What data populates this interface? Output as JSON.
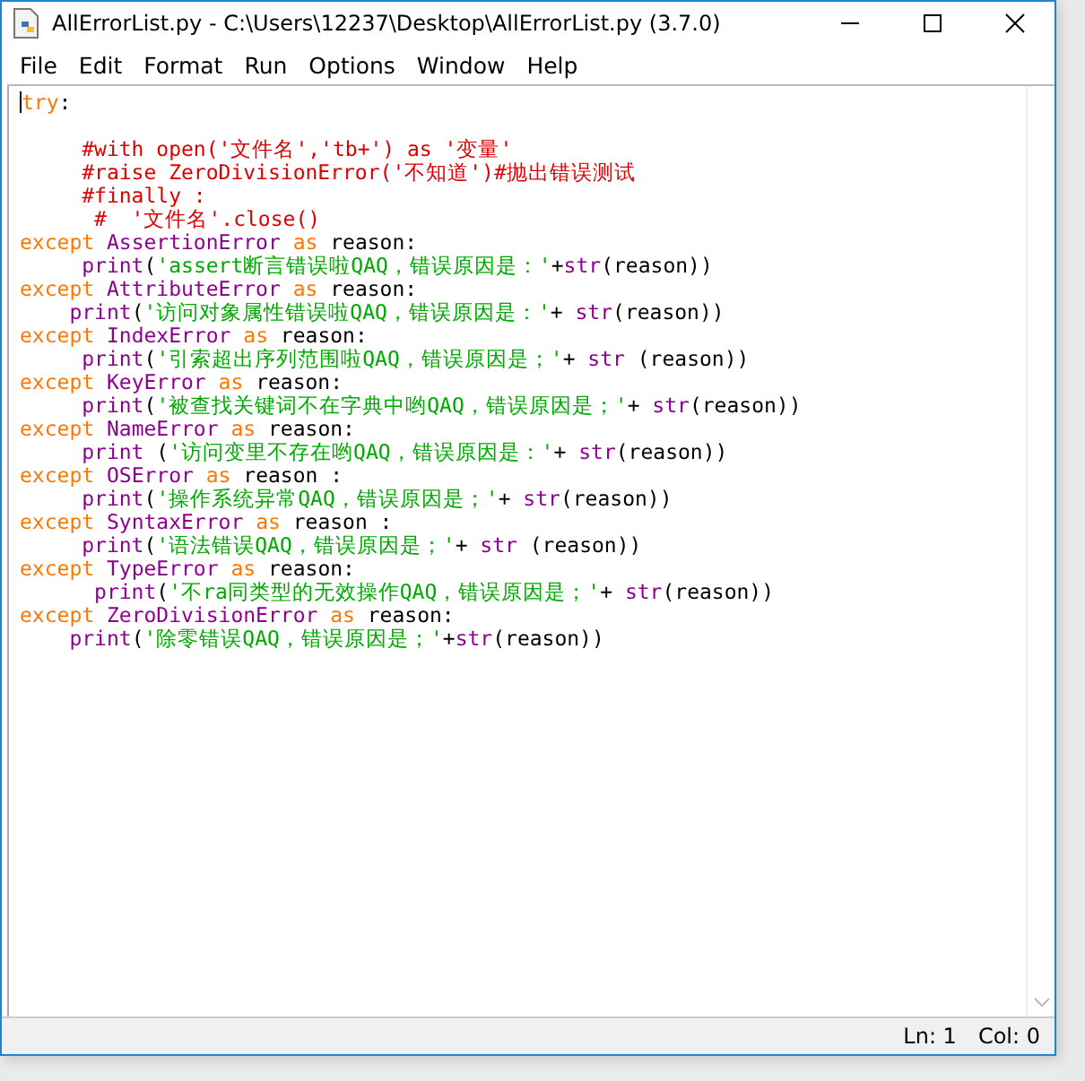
{
  "window": {
    "title": "AllErrorList.py - C:\\Users\\12237\\Desktop\\AllErrorList.py (3.7.0)"
  },
  "menu": [
    "File",
    "Edit",
    "Format",
    "Run",
    "Options",
    "Window",
    "Help"
  ],
  "editor": {
    "lines": [
      {
        "kind": "code",
        "tokens": [
          {
            "kind": "keyword",
            "text": "try"
          },
          {
            "kind": "plain",
            "text": ":"
          }
        ]
      },
      {
        "kind": "blank"
      },
      {
        "kind": "code",
        "tokens": [
          {
            "kind": "comment",
            "text": "     #with open('文件名','tb+') as '变量'"
          }
        ]
      },
      {
        "kind": "code",
        "tokens": [
          {
            "kind": "comment",
            "text": "     #raise ZeroDivisionError('不知道')#抛出错误测试"
          }
        ]
      },
      {
        "kind": "code",
        "tokens": [
          {
            "kind": "comment",
            "text": "     #finally :"
          }
        ]
      },
      {
        "kind": "code",
        "tokens": [
          {
            "kind": "comment",
            "text": "      #  '文件名'.close()"
          }
        ]
      },
      {
        "kind": "code",
        "tokens": [
          {
            "kind": "keyword",
            "text": "except "
          },
          {
            "kind": "builtin",
            "text": "AssertionError "
          },
          {
            "kind": "keyword",
            "text": "as "
          },
          {
            "kind": "plain",
            "text": "reason:"
          }
        ]
      },
      {
        "kind": "code",
        "tokens": [
          {
            "kind": "builtin",
            "text": "     print"
          },
          {
            "kind": "plain",
            "text": "("
          },
          {
            "kind": "string",
            "text": "'assert断言错误啦QAQ，错误原因是：'"
          },
          {
            "kind": "plain",
            "text": "+"
          },
          {
            "kind": "builtin",
            "text": "str"
          },
          {
            "kind": "plain",
            "text": "(reason))"
          }
        ]
      },
      {
        "kind": "code",
        "tokens": [
          {
            "kind": "keyword",
            "text": "except "
          },
          {
            "kind": "builtin",
            "text": "AttributeError "
          },
          {
            "kind": "keyword",
            "text": "as "
          },
          {
            "kind": "plain",
            "text": "reason:"
          }
        ]
      },
      {
        "kind": "code",
        "tokens": [
          {
            "kind": "builtin",
            "text": "    print"
          },
          {
            "kind": "plain",
            "text": "("
          },
          {
            "kind": "string",
            "text": "'访问对象属性错误啦QAQ，错误原因是：'"
          },
          {
            "kind": "plain",
            "text": "+ "
          },
          {
            "kind": "builtin",
            "text": "str"
          },
          {
            "kind": "plain",
            "text": "(reason))"
          }
        ]
      },
      {
        "kind": "code",
        "tokens": [
          {
            "kind": "keyword",
            "text": "except "
          },
          {
            "kind": "builtin",
            "text": "IndexError "
          },
          {
            "kind": "keyword",
            "text": "as "
          },
          {
            "kind": "plain",
            "text": "reason:"
          }
        ]
      },
      {
        "kind": "code",
        "tokens": [
          {
            "kind": "builtin",
            "text": "     print"
          },
          {
            "kind": "plain",
            "text": "("
          },
          {
            "kind": "string",
            "text": "'引索超出序列范围啦QAQ，错误原因是；'"
          },
          {
            "kind": "plain",
            "text": "+ "
          },
          {
            "kind": "builtin",
            "text": "str"
          },
          {
            "kind": "plain",
            "text": " (reason))"
          }
        ]
      },
      {
        "kind": "code",
        "tokens": [
          {
            "kind": "keyword",
            "text": "except "
          },
          {
            "kind": "builtin",
            "text": "KeyError "
          },
          {
            "kind": "keyword",
            "text": "as "
          },
          {
            "kind": "plain",
            "text": "reason:"
          }
        ]
      },
      {
        "kind": "code",
        "tokens": [
          {
            "kind": "builtin",
            "text": "     print"
          },
          {
            "kind": "plain",
            "text": "("
          },
          {
            "kind": "string",
            "text": "'被查找关键词不在字典中哟QAQ，错误原因是；'"
          },
          {
            "kind": "plain",
            "text": "+ "
          },
          {
            "kind": "builtin",
            "text": "str"
          },
          {
            "kind": "plain",
            "text": "(reason))"
          }
        ]
      },
      {
        "kind": "code",
        "tokens": [
          {
            "kind": "keyword",
            "text": "except "
          },
          {
            "kind": "builtin",
            "text": "NameError "
          },
          {
            "kind": "keyword",
            "text": "as "
          },
          {
            "kind": "plain",
            "text": "reason:"
          }
        ]
      },
      {
        "kind": "code",
        "tokens": [
          {
            "kind": "builtin",
            "text": "     print"
          },
          {
            "kind": "plain",
            "text": " ("
          },
          {
            "kind": "string",
            "text": "'访问变里不存在哟QAQ，错误原因是：'"
          },
          {
            "kind": "plain",
            "text": "+ "
          },
          {
            "kind": "builtin",
            "text": "str"
          },
          {
            "kind": "plain",
            "text": "(reason))"
          }
        ]
      },
      {
        "kind": "code",
        "tokens": [
          {
            "kind": "keyword",
            "text": "except "
          },
          {
            "kind": "builtin",
            "text": "OSError "
          },
          {
            "kind": "keyword",
            "text": "as "
          },
          {
            "kind": "plain",
            "text": "reason :"
          }
        ]
      },
      {
        "kind": "code",
        "tokens": [
          {
            "kind": "builtin",
            "text": "     print"
          },
          {
            "kind": "plain",
            "text": "("
          },
          {
            "kind": "string",
            "text": "'操作系统异常QAQ，错误原因是；'"
          },
          {
            "kind": "plain",
            "text": "+ "
          },
          {
            "kind": "builtin",
            "text": "str"
          },
          {
            "kind": "plain",
            "text": "(reason))"
          }
        ]
      },
      {
        "kind": "code",
        "tokens": [
          {
            "kind": "keyword",
            "text": "except "
          },
          {
            "kind": "builtin",
            "text": "SyntaxError "
          },
          {
            "kind": "keyword",
            "text": "as "
          },
          {
            "kind": "plain",
            "text": "reason :"
          }
        ]
      },
      {
        "kind": "code",
        "tokens": [
          {
            "kind": "builtin",
            "text": "     print"
          },
          {
            "kind": "plain",
            "text": "("
          },
          {
            "kind": "string",
            "text": "'语法错误QAQ，错误原因是；'"
          },
          {
            "kind": "plain",
            "text": "+ "
          },
          {
            "kind": "builtin",
            "text": "str"
          },
          {
            "kind": "plain",
            "text": " (reason))"
          }
        ]
      },
      {
        "kind": "code",
        "tokens": [
          {
            "kind": "keyword",
            "text": "except "
          },
          {
            "kind": "builtin",
            "text": "TypeError "
          },
          {
            "kind": "keyword",
            "text": "as "
          },
          {
            "kind": "plain",
            "text": "reason:"
          }
        ]
      },
      {
        "kind": "code",
        "tokens": [
          {
            "kind": "builtin",
            "text": "      print"
          },
          {
            "kind": "plain",
            "text": "("
          },
          {
            "kind": "string",
            "text": "'不ra同类型的无效操作QAQ，错误原因是；'"
          },
          {
            "kind": "plain",
            "text": "+ "
          },
          {
            "kind": "builtin",
            "text": "str"
          },
          {
            "kind": "plain",
            "text": "(reason))"
          }
        ]
      },
      {
        "kind": "code",
        "tokens": [
          {
            "kind": "keyword",
            "text": "except "
          },
          {
            "kind": "builtin",
            "text": "ZeroDivisionError "
          },
          {
            "kind": "keyword",
            "text": "as "
          },
          {
            "kind": "plain",
            "text": "reason:"
          }
        ]
      },
      {
        "kind": "code",
        "tokens": [
          {
            "kind": "builtin",
            "text": "    print"
          },
          {
            "kind": "plain",
            "text": "("
          },
          {
            "kind": "string",
            "text": "'除零错误QAQ，错误原因是；'"
          },
          {
            "kind": "plain",
            "text": "+"
          },
          {
            "kind": "builtin",
            "text": "str"
          },
          {
            "kind": "plain",
            "text": "(reason))"
          }
        ]
      }
    ]
  },
  "status_bar": {
    "line": "Ln: 1",
    "column": "Col: 0"
  }
}
